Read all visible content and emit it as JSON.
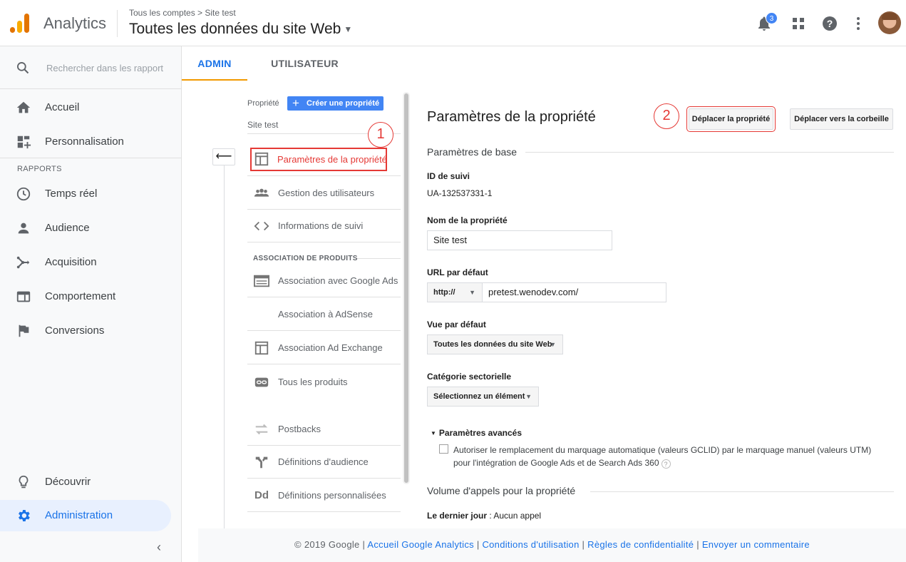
{
  "header": {
    "app_name": "Analytics",
    "breadcrumb": "Tous les comptes > Site test",
    "view_name": "Toutes les données du site Web",
    "notification_count": "3"
  },
  "sidebar": {
    "search_placeholder": "Rechercher dans les rapport",
    "top_items": [
      {
        "label": "Accueil",
        "icon": "home-icon"
      },
      {
        "label": "Personnalisation",
        "icon": "dashboard-plus-icon"
      }
    ],
    "reports_label": "RAPPORTS",
    "report_items": [
      {
        "label": "Temps réel",
        "icon": "clock-icon"
      },
      {
        "label": "Audience",
        "icon": "person-icon"
      },
      {
        "label": "Acquisition",
        "icon": "acquisition-icon"
      },
      {
        "label": "Comportement",
        "icon": "behavior-icon"
      },
      {
        "label": "Conversions",
        "icon": "flag-icon"
      }
    ],
    "bottom_items": [
      {
        "label": "Découvrir",
        "icon": "lightbulb-icon"
      },
      {
        "label": "Administration",
        "icon": "gear-icon"
      }
    ]
  },
  "tabs": {
    "admin": "ADMIN",
    "user": "UTILISATEUR"
  },
  "property_panel": {
    "property_label": "Propriété",
    "create_button": "Créer une propriété",
    "site_name": "Site test",
    "items": [
      {
        "label": "Paramètres de la propriété",
        "icon": "layout-icon"
      },
      {
        "label": "Gestion des utilisateurs",
        "icon": "group-icon"
      },
      {
        "label": "Informations de suivi",
        "icon": "code-icon"
      }
    ],
    "product_section": "ASSOCIATION DE PRODUITS",
    "product_items": [
      {
        "label": "Association avec Google Ads",
        "icon": "ads-icon"
      },
      {
        "label": "Association à AdSense",
        "icon": ""
      },
      {
        "label": "Association Ad Exchange",
        "icon": "layout-icon"
      },
      {
        "label": "Tous les produits",
        "icon": "link-icon"
      }
    ],
    "other_items": [
      {
        "label": "Postbacks",
        "icon": "swap-icon"
      },
      {
        "label": "Définitions d'audience",
        "icon": "fork-icon"
      },
      {
        "label": "Définitions personnalisées",
        "icon": "dd-icon",
        "icon_text": "Dd"
      }
    ],
    "annotation_1": "1"
  },
  "settings": {
    "title": "Paramètres de la propriété",
    "annotation_2": "2",
    "move_property_button": "Déplacer la propriété",
    "move_trash_button": "Déplacer vers la corbeille",
    "basic_section": "Paramètres de base",
    "tracking_id_label": "ID de suivi",
    "tracking_id_value": "UA-132537331-1",
    "property_name_label": "Nom de la propriété",
    "property_name_value": "Site test",
    "default_url_label": "URL par défaut",
    "protocol": "http://",
    "default_url_value": "pretest.wenodev.com/",
    "default_view_label": "Vue par défaut",
    "default_view_value": "Toutes les données du site Web",
    "category_label": "Catégorie sectorielle",
    "category_value": "Sélectionnez un élément",
    "advanced_label": "Paramètres avancés",
    "auto_tagging_text": "Autoriser le remplacement du marquage automatique (valeurs GCLID) par le marquage manuel (valeurs UTM) pour l'intégration de Google Ads et de Search Ads 360",
    "volume_section": "Volume d'appels pour la propriété",
    "last_day_label": "Le dernier jour",
    "last_day_value": " : Aucun appel"
  },
  "footer": {
    "copyright": "© 2019 Google",
    "sep": " | ",
    "links": [
      "Accueil Google Analytics",
      "Conditions d'utilisation",
      "Règles de confidentialité",
      "Envoyer un commentaire"
    ]
  }
}
